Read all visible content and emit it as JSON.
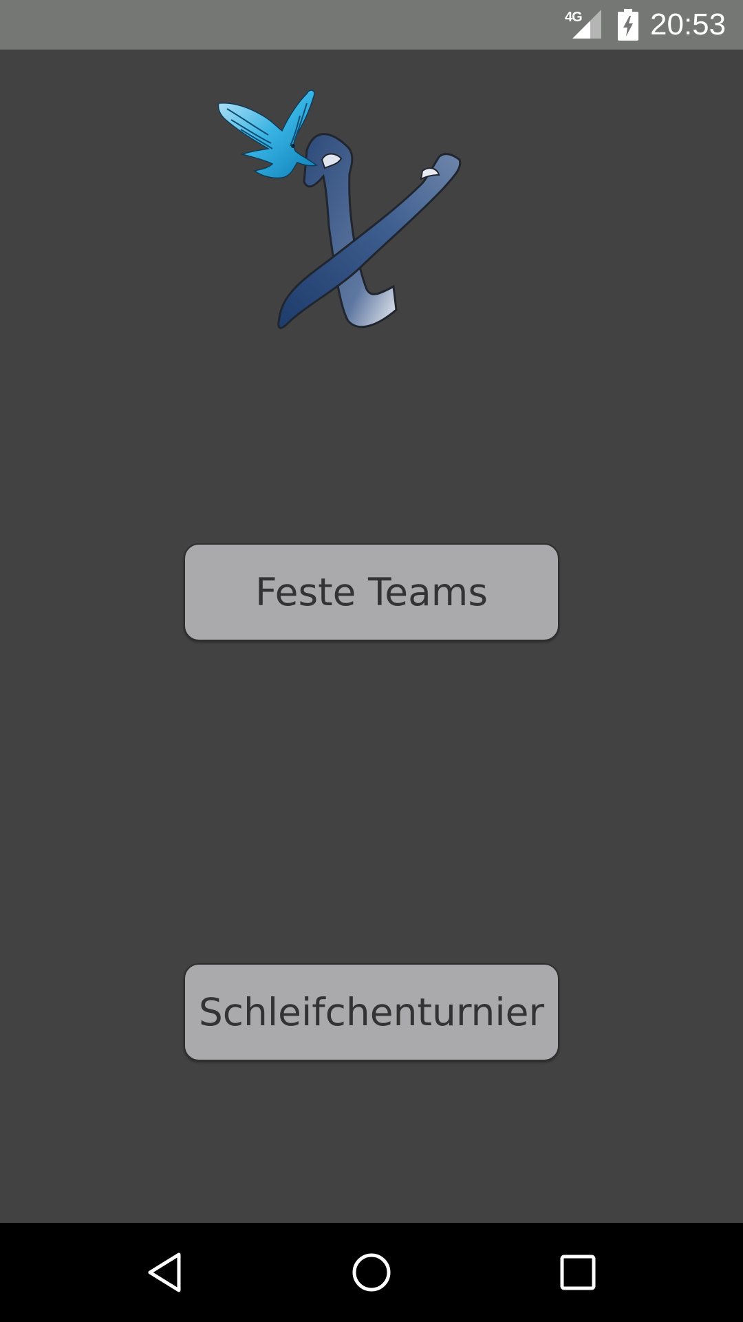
{
  "status_bar": {
    "network": "4G",
    "time": "20:53",
    "icons": [
      "signal-icon",
      "battery-charging-icon"
    ]
  },
  "logo": {
    "icon": "eagle-x-logo"
  },
  "buttons": {
    "feste_teams": "Feste Teams",
    "schleifchenturnier": "Schleifchenturnier"
  },
  "nav_bar": {
    "icons": [
      "back-icon",
      "home-icon",
      "recents-icon"
    ]
  },
  "colors": {
    "background": "#424242",
    "status_bar": "#757775",
    "button": "#aaa9ab",
    "button_text": "#333333",
    "nav_bar": "#000000"
  }
}
